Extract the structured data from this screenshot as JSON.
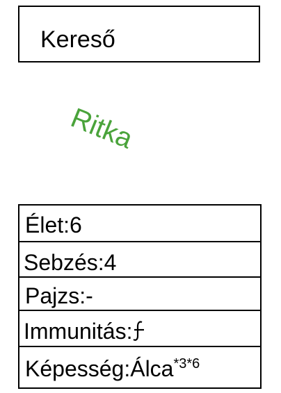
{
  "card": {
    "name": "Kereső",
    "rarity": "Ritka",
    "rarity_color": "#4aa33b",
    "stats": {
      "life": "Élet:6",
      "damage": "Sebzés:4",
      "shield": "Pajzs:-",
      "immunity_label": "Immunitás:",
      "immunity_icon": "hook-f-glyph-icon",
      "ability_label": "Képesség:Álca",
      "ability_sup1": "*3",
      "ability_sup2": "*6"
    }
  }
}
